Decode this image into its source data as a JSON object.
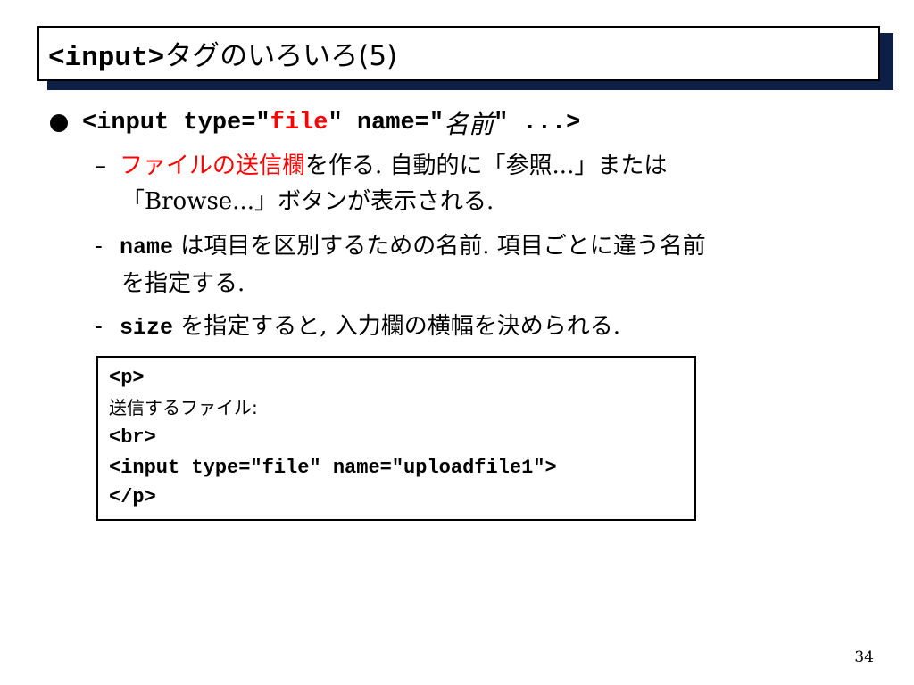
{
  "title": {
    "tag": "<input>",
    "rest": "タグのいろいろ(5)"
  },
  "bullet": {
    "part1": "<input type=\"",
    "file": "file",
    "part2": "\" name=\"",
    "name_italic": "名前",
    "part3": "\" ...>"
  },
  "items": [
    {
      "dash": "–",
      "red": "ファイルの送信欄",
      "line1_rest": "を作る. 自動的に「参照...」または",
      "line2": "「Browse...」ボタンが表示される."
    },
    {
      "dash": "-",
      "code": "name",
      "line1_rest": " は項目を区別するための名前. 項目ごとに違う名前",
      "line2": "を指定する."
    },
    {
      "dash": "-",
      "code": "size",
      "line1_rest": " を指定すると, 入力欄の横幅を決められる."
    }
  ],
  "code_example": [
    "<p>",
    "送信するファイル:",
    "<br>",
    "<input type=\"file\" name=\"uploadfile1\">",
    "</p>"
  ],
  "page_number": "34"
}
